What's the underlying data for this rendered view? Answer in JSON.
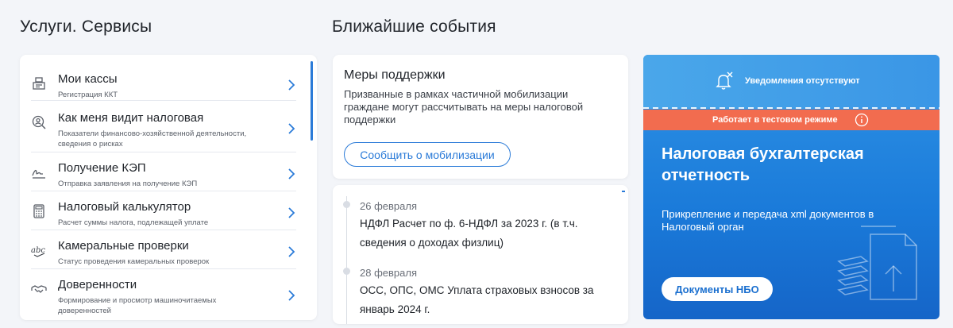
{
  "sections": {
    "services_title": "Услуги. Сервисы",
    "events_title": "Ближайшие события"
  },
  "services": [
    {
      "title": "Мои кассы",
      "subtitle": "Регистрация ККТ",
      "icon": "cash-register-icon"
    },
    {
      "title": "Как меня видит налоговая",
      "subtitle": "Показатели финансово-хозяйственной деятельности, сведения о рисках",
      "icon": "magnifier-person-icon"
    },
    {
      "title": "Получение КЭП",
      "subtitle": "Отправка заявления на получение КЭП",
      "icon": "signature-icon"
    },
    {
      "title": "Налоговый калькулятор",
      "subtitle": "Расчет суммы налога, подлежащей уплате",
      "icon": "calculator-icon"
    },
    {
      "title": "Камеральные проверки",
      "subtitle": "Статус проведения камеральных проверок",
      "icon": "abc-check-icon"
    },
    {
      "title": "Доверенности",
      "subtitle": "Формирование и просмотр машиночитаемых доверенностей",
      "icon": "handshake-icon"
    }
  ],
  "support": {
    "title": "Меры поддержки",
    "text": "Призванные в рамках частичной мобилизации граждане могут рассчитывать на меры налоговой поддержки",
    "button": "Сообщить о мобилизации"
  },
  "events": [
    {
      "date": "26 февраля",
      "text": "НДФЛ Расчет по ф. 6-НДФЛ за 2023 г. (в т.ч. сведения о доходах физлиц)"
    },
    {
      "date": "28 февраля",
      "text": "ОСС, ОПС, ОМС Уплата страховых взносов за январь 2024 г."
    }
  ],
  "banner": {
    "notifications": "Уведомления отсутствуют",
    "test_mode": "Работает в тестовом режиме",
    "title": "Налоговая бухгалтерская отчетность",
    "description": "Прикрепление и передача xml документов в Налоговый орган",
    "button": "Документы НБО"
  },
  "colors": {
    "accent": "#2b7bd8",
    "banner_blue": "#1a7ad9",
    "banner_orange": "#f26c4f"
  }
}
